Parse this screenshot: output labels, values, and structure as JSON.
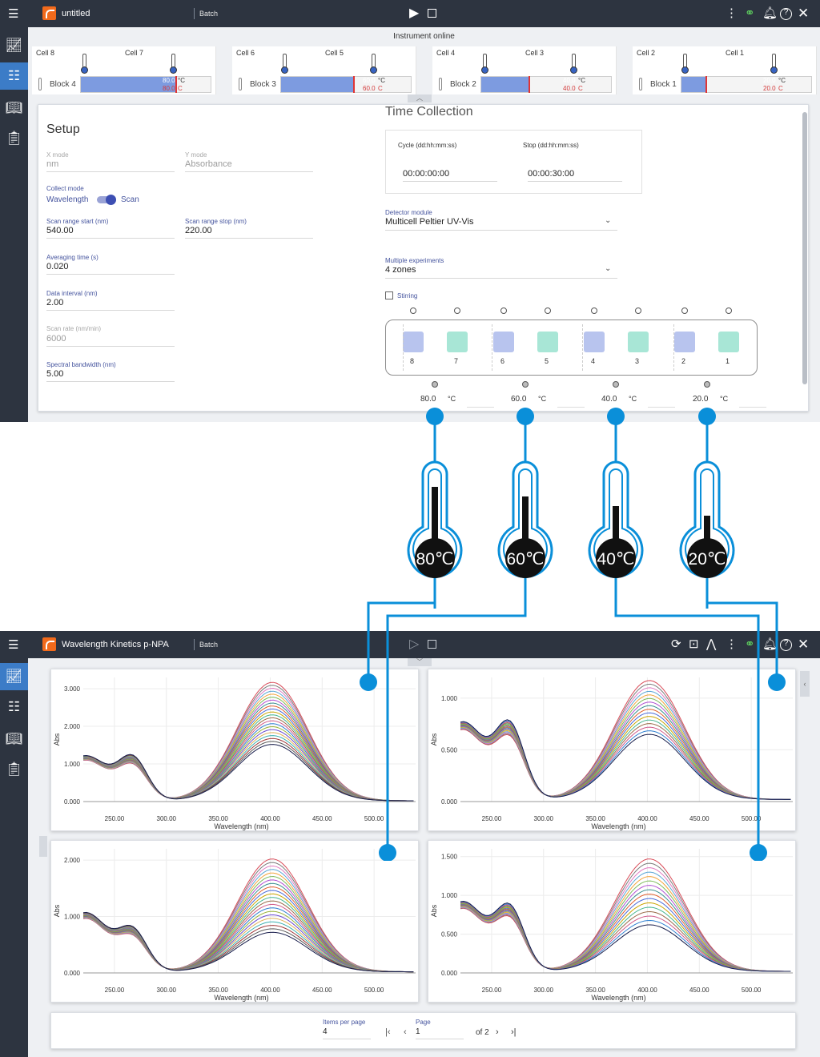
{
  "top_window": {
    "title": "untitled",
    "mode": "Batch",
    "status": "Instrument online",
    "cells": [
      {
        "left": "Cell 8",
        "right": "Cell 7",
        "block": "Block 4",
        "set": "80.0",
        "actual": "80.0",
        "unit": "°C"
      },
      {
        "left": "Cell 6",
        "right": "Cell 5",
        "block": "Block 3",
        "set": "60.0",
        "actual": "60.0",
        "unit": "°C"
      },
      {
        "left": "Cell 4",
        "right": "Cell 3",
        "block": "Block 2",
        "set": "40.0",
        "actual": "40.0",
        "unit": "°C"
      },
      {
        "left": "Cell 2",
        "right": "Cell 1",
        "block": "Block 1",
        "set": "20.0",
        "actual": "20.0",
        "unit": "°C"
      }
    ]
  },
  "setup": {
    "title": "Setup",
    "x_mode_label": "X mode",
    "x_mode": "nm",
    "y_mode_label": "Y mode",
    "y_mode": "Absorbance",
    "collect_mode_label": "Collect mode",
    "collect_wavelength": "Wavelength",
    "collect_scan": "Scan",
    "scan_start_label": "Scan range start (nm)",
    "scan_start": "540.00",
    "scan_stop_label": "Scan range stop (nm)",
    "scan_stop": "220.00",
    "avg_time_label": "Averaging time (s)",
    "avg_time": "0.020",
    "data_interval_label": "Data interval (nm)",
    "data_interval": "2.00",
    "scan_rate_label": "Scan rate (nm/min)",
    "scan_rate": "6000",
    "bandwidth_label": "Spectral bandwidth (nm)",
    "bandwidth": "5.00"
  },
  "time_collection": {
    "title": "Time Collection",
    "cycle_label": "Cycle (dd:hh:mm:ss)",
    "cycle": "00:00:00:00",
    "stop_label": "Stop (dd:hh:mm:ss)",
    "stop": "00:00:30:00",
    "detector_label": "Detector module",
    "detector": "Multicell Peltier UV-Vis",
    "multiple_label": "Multiple experiments",
    "multiple": "4 zones",
    "stirring_label": "Stirring",
    "cell_numbers": [
      "8",
      "7",
      "6",
      "5",
      "4",
      "3",
      "2",
      "1"
    ],
    "zone_temps": [
      "80.0",
      "60.0",
      "40.0",
      "20.0"
    ],
    "temp_unit": "°C"
  },
  "thermometers": [
    {
      "label": "80℃",
      "fill_fraction": 0.9
    },
    {
      "label": "60℃",
      "fill_fraction": 0.7
    },
    {
      "label": "40℃",
      "fill_fraction": 0.5
    },
    {
      "label": "20℃",
      "fill_fraction": 0.3
    }
  ],
  "bottom_window": {
    "title": "Wavelength Kinetics p-NPA",
    "mode": "Batch",
    "items_per_page_label": "Items per page",
    "items_per_page": "4",
    "page_label": "Page",
    "page": "1",
    "of_pages": "of 2"
  },
  "chart_data": [
    {
      "type": "line",
      "title": "",
      "xlabel": "Wavelength (nm)",
      "ylabel": "Abs",
      "xlim": [
        220,
        540
      ],
      "ylim": [
        0,
        3.3
      ],
      "xticks": [
        "250.00",
        "300.00",
        "350.00",
        "400.00",
        "450.00",
        "500.00"
      ],
      "yticks": [
        "0.000",
        "1.000",
        "2.000",
        "3.000"
      ],
      "peak_top": 3.15,
      "peak_bottom": 1.5,
      "uv_band": 1.2,
      "shoulder": 0.9,
      "curves": 22
    },
    {
      "type": "line",
      "title": "",
      "xlabel": "Wavelength (nm)",
      "ylabel": "Abs",
      "xlim": [
        220,
        540
      ],
      "ylim": [
        0,
        1.2
      ],
      "xticks": [
        "250.00",
        "300.00",
        "350.00",
        "400.00",
        "450.00",
        "500.00"
      ],
      "yticks": [
        "0.000",
        "0.500",
        "1.000"
      ],
      "peak_top": 1.15,
      "peak_bottom": 0.63,
      "uv_band": 0.75,
      "shoulder": 0.9,
      "curves": 16
    },
    {
      "type": "line",
      "title": "",
      "xlabel": "Wavelength (nm)",
      "ylabel": "Abs",
      "xlim": [
        220,
        540
      ],
      "ylim": [
        0,
        2.2
      ],
      "xticks": [
        "250.00",
        "300.00",
        "350.00",
        "400.00",
        "450.00",
        "500.00"
      ],
      "yticks": [
        "0.000",
        "1.000",
        "2.000"
      ],
      "peak_top": 2.0,
      "peak_bottom": 0.7,
      "uv_band": 1.05,
      "shoulder": 0.65,
      "curves": 22
    },
    {
      "type": "line",
      "title": "",
      "xlabel": "Wavelength (nm)",
      "ylabel": "Abs",
      "xlim": [
        220,
        540
      ],
      "ylim": [
        0,
        1.6
      ],
      "xticks": [
        "250.00",
        "300.00",
        "350.00",
        "400.00",
        "450.00",
        "500.00"
      ],
      "yticks": [
        "0.000",
        "0.500",
        "1.000",
        "1.500"
      ],
      "peak_top": 1.45,
      "peak_bottom": 0.6,
      "uv_band": 0.9,
      "shoulder": 0.85,
      "curves": 16
    }
  ],
  "colors": {
    "appbar": "#2d3440",
    "accent": "#0a8fd9",
    "active": "#3c7cc7",
    "thermo": "#0a8fd9"
  }
}
